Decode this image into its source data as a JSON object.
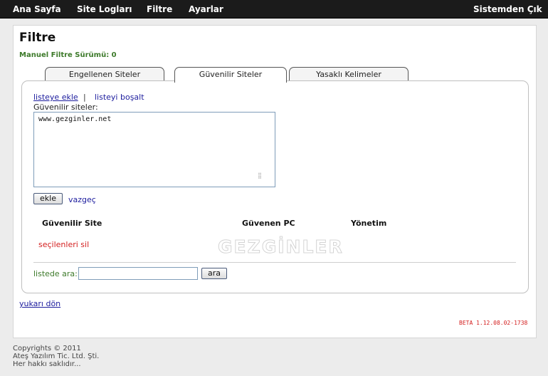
{
  "nav": {
    "home": "Ana Sayfa",
    "site_logs": "Site Logları",
    "filter": "Filtre",
    "settings": "Ayarlar",
    "logout": "Sistemden Çık"
  },
  "page": {
    "title": "Filtre",
    "version": "Manuel Filtre Sürümü: 0"
  },
  "tabs": [
    {
      "label": "Engellenen Siteler",
      "active": false
    },
    {
      "label": "Güvenilir Siteler",
      "active": true
    },
    {
      "label": "Yasaklı Kelimeler",
      "active": false
    }
  ],
  "actions": {
    "add_to_list": "listeye ekle",
    "separator": "|",
    "clear_list": "listeyi boşalt"
  },
  "trusted_sites_label": "Güvenilir siteler:",
  "textarea_value": "www.gezginler.net",
  "buttons": {
    "add": "ekle",
    "cancel": "vazgeç",
    "search": "ara"
  },
  "table": {
    "headers": [
      "Güvenilir Site",
      "Güvenen PC",
      "Yönetim"
    ],
    "rows": []
  },
  "delete_selected": "seçilenleri sil",
  "search": {
    "label": "listede ara:",
    "value": ""
  },
  "watermark": "GEZGİNLER",
  "back_to_top": "yukarı dön",
  "beta_version": "BETA 1.12.08.02-1738",
  "footer": {
    "copyright": "Copyrights © 2011",
    "company": "Ateş Yazılım Tic. Ltd. Şti.",
    "rights": "Her hakkı saklıdır..."
  },
  "colors": {
    "topbar": "#1b1b1b",
    "green_text": "#3d7a2a",
    "red_text": "#d42020",
    "link": "#1d1d9e"
  }
}
